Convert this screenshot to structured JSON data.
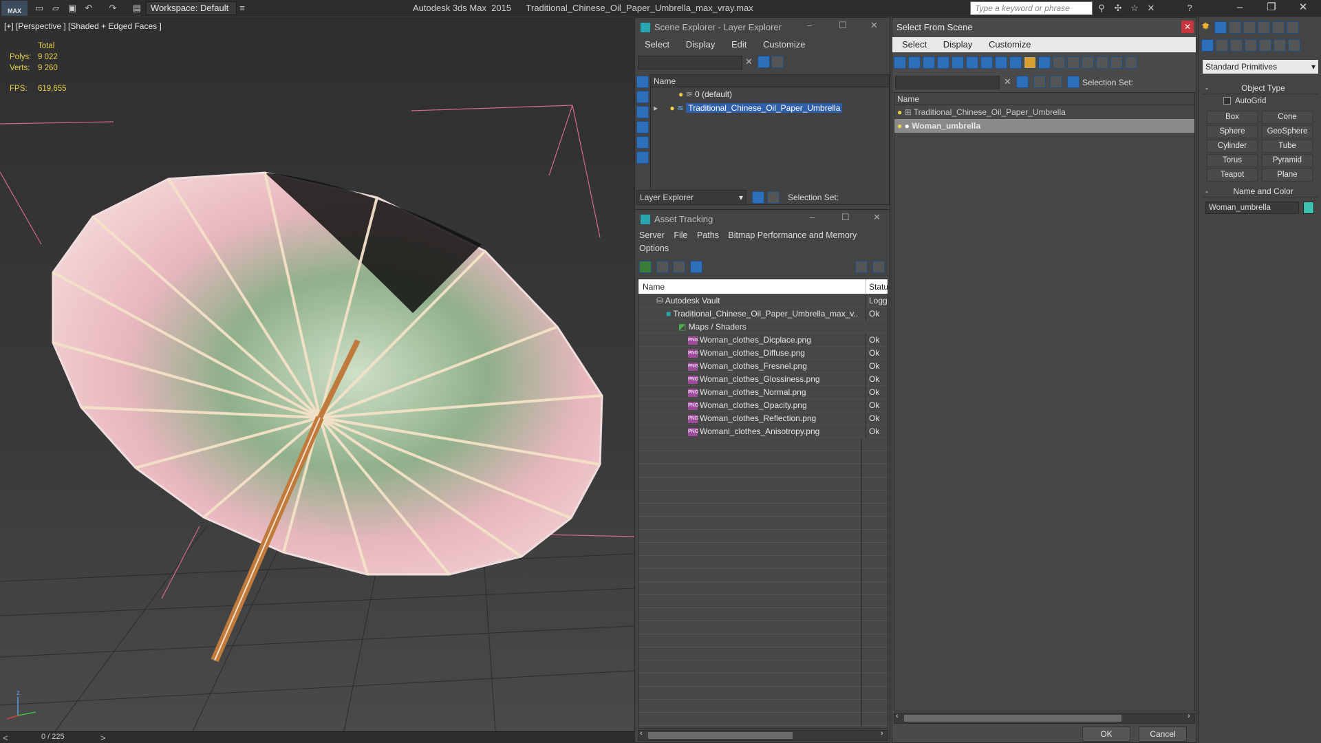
{
  "titlebar": {
    "logo": "MAX",
    "workspace": "Workspace: Default",
    "app_title": "Autodesk 3ds Max  2015      Traditional_Chinese_Oil_Paper_Umbrella_max_vray.max",
    "search_placeholder": "Type a keyword or phrase"
  },
  "viewport": {
    "label": "[+] [Perspective ] [Shaded + Edged Faces ]",
    "stats": {
      "total_label": "Total",
      "polys_label": "Polys:",
      "polys_value": "9 022",
      "verts_label": "Verts:",
      "verts_value": "9 260",
      "fps_label": "FPS:",
      "fps_value": "619,655"
    }
  },
  "timeline": {
    "frame": "0 / 225",
    "prev": "<",
    "next": ">"
  },
  "scene_explorer": {
    "title": "Scene Explorer - Layer Explorer",
    "menu": [
      "Select",
      "Display",
      "Edit",
      "Customize"
    ],
    "column": "Name",
    "rows": [
      "0 (default)",
      "Traditional_Chinese_Oil_Paper_Umbrella"
    ],
    "footer_dropdown": "Layer Explorer",
    "selection_set": "Selection Set:"
  },
  "asset_tracking": {
    "title": "Asset Tracking",
    "menu": [
      "Server",
      "File",
      "Paths",
      "Bitmap Performance and Memory",
      "Options"
    ],
    "columns": {
      "name": "Name",
      "status": "Status"
    },
    "rows": [
      {
        "name": "Autodesk Vault",
        "status": "Logged"
      },
      {
        "name": "Traditional_Chinese_Oil_Paper_Umbrella_max_v...",
        "status": "Ok"
      },
      {
        "name": "Maps / Shaders",
        "status": ""
      },
      {
        "name": "Woman_clothes_Dicplace.png",
        "status": "Ok"
      },
      {
        "name": "Woman_clothes_Diffuse.png",
        "status": "Ok"
      },
      {
        "name": "Woman_clothes_Fresnel.png",
        "status": "Ok"
      },
      {
        "name": "Woman_clothes_Glossiness.png",
        "status": "Ok"
      },
      {
        "name": "Woman_clothes_Normal.png",
        "status": "Ok"
      },
      {
        "name": "Woman_clothes_Opacity.png",
        "status": "Ok"
      },
      {
        "name": "Woman_clothes_Reflection.png",
        "status": "Ok"
      },
      {
        "name": "Womanl_clothes_Anisotropy.png",
        "status": "Ok"
      }
    ],
    "png_tag": "PNG"
  },
  "select_from_scene": {
    "title": "Select From Scene",
    "menu": [
      "Select",
      "Display",
      "Customize"
    ],
    "selection_set": "Selection Set:",
    "column": "Name",
    "rows": [
      "Traditional_Chinese_Oil_Paper_Umbrella",
      "Woman_umbrella"
    ],
    "ok": "OK",
    "cancel": "Cancel"
  },
  "command_panel": {
    "dropdown": "Standard Primitives",
    "object_type": "Object Type",
    "autogrid": "AutoGrid",
    "buttons": [
      "Box",
      "Cone",
      "Sphere",
      "GeoSphere",
      "Cylinder",
      "Tube",
      "Torus",
      "Pyramid",
      "Teapot",
      "Plane"
    ],
    "name_and_color": "Name and Color",
    "object_name": "Woman_umbrella",
    "color": "#3fc1b0"
  }
}
